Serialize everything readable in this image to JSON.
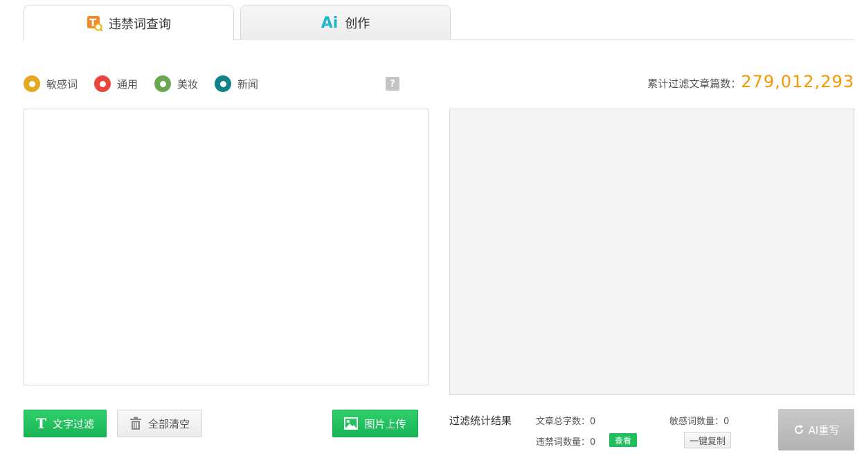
{
  "tabs": [
    {
      "label": "违禁词查询",
      "icon": "text-search-icon",
      "active": true
    },
    {
      "label": "创作",
      "logo": "Ai",
      "icon": "ai-logo-icon",
      "active": false
    }
  ],
  "categories": [
    {
      "label": "敏感词",
      "color": "#e6a823",
      "icon": "radio-icon"
    },
    {
      "label": "通用",
      "color": "#e8453c",
      "icon": "radio-icon"
    },
    {
      "label": "美妆",
      "color": "#6aa84f",
      "icon": "radio-icon"
    },
    {
      "label": "新闻",
      "color": "#128289",
      "icon": "radio-icon"
    }
  ],
  "help": {
    "label": "?"
  },
  "counter": {
    "label": "累计过滤文章篇数：",
    "value": "279,012,293"
  },
  "actions": {
    "text_filter": "文字过滤",
    "clear_all": "全部清空",
    "image_upload": "图片上传"
  },
  "stats": {
    "title": "过滤统计结果",
    "total_chars_label": "文章总字数：",
    "total_chars": "0",
    "banned_label": "违禁词数量：",
    "banned": "0",
    "sensitive_label": "敏感词数量：",
    "sensitive": "0",
    "view_label": "查看",
    "copy_label": "一键复制"
  },
  "ai_rewrite": {
    "label": "AI重写",
    "icon": "refresh-icon"
  },
  "colors": {
    "accent_green": "#1fbf5f",
    "counter_orange": "#f39800",
    "ai_cyan": "#1fb7c9"
  }
}
